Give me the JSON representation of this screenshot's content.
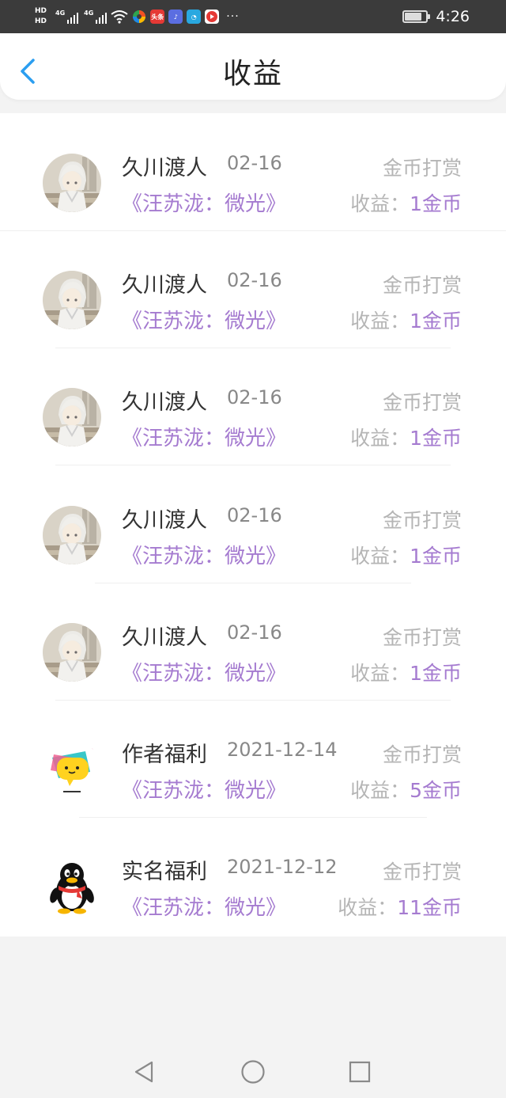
{
  "status_bar": {
    "hd1": "HD",
    "hd2": "HD",
    "net1": "4G",
    "net2": "4G",
    "time": "4:26",
    "battery_level": 0.75,
    "icons": [
      "signal-icon",
      "signal-icon",
      "wifi-icon",
      "app-icon",
      "toutiao-app-icon",
      "music-app-icon",
      "browser-app-icon",
      "video-app-icon",
      "more-dots-icon",
      "battery-icon"
    ],
    "toutiao_text": "头条",
    "more": "···"
  },
  "header": {
    "title": "收益",
    "back_icon": "chevron-left-icon",
    "accent": "#2b9ef0"
  },
  "colors": {
    "accent_purple": "#a57bd0",
    "muted": "#b5b5b5"
  },
  "rows": [
    {
      "name": "久川渡人",
      "date": "02-16",
      "type": "金币打赏",
      "book": "《汪苏泷：微光》",
      "earn_label": "收益：",
      "earn_amount": "1金币",
      "avatar": "anime-avatar"
    },
    {
      "name": "久川渡人",
      "date": "02-16",
      "type": "金币打赏",
      "book": "《汪苏泷：微光》",
      "earn_label": "收益：",
      "earn_amount": "1金币",
      "avatar": "anime-avatar"
    },
    {
      "name": "久川渡人",
      "date": "02-16",
      "type": "金币打赏",
      "book": "《汪苏泷：微光》",
      "earn_label": "收益：",
      "earn_amount": "1金币",
      "avatar": "anime-avatar"
    },
    {
      "name": "久川渡人",
      "date": "02-16",
      "type": "金币打赏",
      "book": "《汪苏泷：微光》",
      "earn_label": "收益：",
      "earn_amount": "1金币",
      "avatar": "anime-avatar"
    },
    {
      "name": "久川渡人",
      "date": "02-16",
      "type": "金币打赏",
      "book": "《汪苏泷：微光》",
      "earn_label": "收益：",
      "earn_amount": "1金币",
      "avatar": "anime-avatar"
    },
    {
      "name": "作者福利",
      "date": "2021-12-14",
      "type": "金币打赏",
      "book": "《汪苏泷：微光》",
      "earn_label": "收益：",
      "earn_amount": "5金币",
      "avatar": "chat-bubble-avatar"
    },
    {
      "name": "实名福利",
      "date": "2021-12-12",
      "type": "金币打赏",
      "book": "《汪苏泷：微光》",
      "earn_label": "收益：",
      "earn_amount": "11金币",
      "avatar": "qq-penguin-avatar"
    }
  ],
  "nav_bar": {
    "icons": [
      "back-triangle-icon",
      "home-circle-icon",
      "recents-square-icon"
    ]
  }
}
